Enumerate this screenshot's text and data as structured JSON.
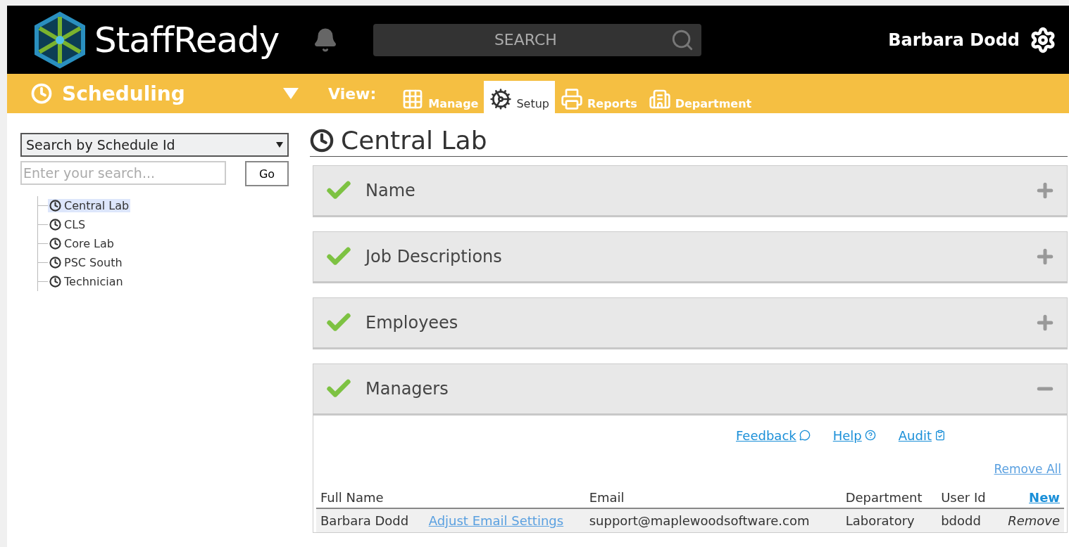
{
  "brand": "StaffReady",
  "search": {
    "placeholder": "SEARCH"
  },
  "user": "Barbara Dodd",
  "module": "Scheduling",
  "view_label": "View:",
  "views": [
    {
      "label": "Manage",
      "selected": false
    },
    {
      "label": "Setup",
      "selected": true
    },
    {
      "label": "Reports",
      "selected": false
    },
    {
      "label": "Department",
      "selected": false
    }
  ],
  "sidebar": {
    "search_type": "Search by Schedule Id",
    "placeholder": "Enter your search...",
    "go": "Go",
    "tree": [
      {
        "label": "Central Lab",
        "selected": true
      },
      {
        "label": "CLS",
        "selected": false
      },
      {
        "label": "Core Lab",
        "selected": false
      },
      {
        "label": "PSC South",
        "selected": false
      },
      {
        "label": "Technician",
        "selected": false
      }
    ]
  },
  "title": "Central Lab",
  "sections": [
    {
      "title": "Name",
      "complete": true,
      "expanded": false
    },
    {
      "title": "Job Descriptions",
      "complete": true,
      "expanded": false
    },
    {
      "title": "Employees",
      "complete": true,
      "expanded": false
    },
    {
      "title": "Managers",
      "complete": true,
      "expanded": true,
      "links": [
        "Feedback",
        "Help",
        "Audit"
      ],
      "remove_all": "Remove All",
      "table": {
        "columns": [
          "Full Name",
          "Email",
          "Department",
          "User Id"
        ],
        "new_link": "New",
        "rows": [
          {
            "full_name": "Barbara Dodd",
            "link": "Adjust Email Settings",
            "email": "support@maplewoodsoftware.com",
            "department": "Laboratory",
            "user_id": "bdodd",
            "action": "Remove"
          }
        ]
      }
    }
  ]
}
